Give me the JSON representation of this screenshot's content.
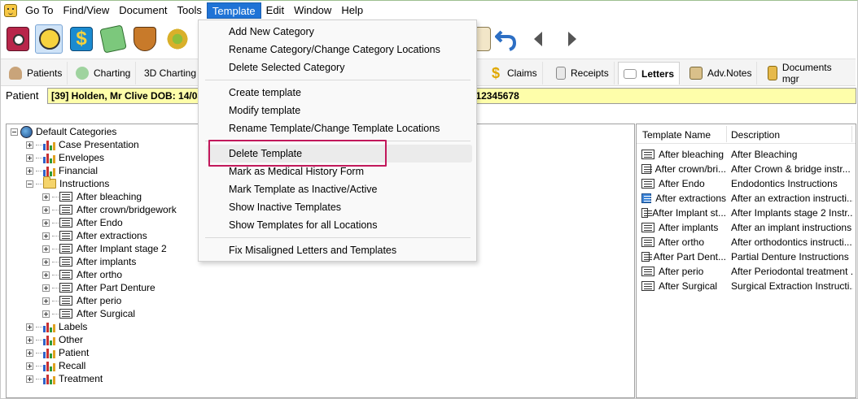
{
  "menubar": {
    "items": [
      "Go To",
      "Find/View",
      "Document",
      "Tools",
      "Template",
      "Edit",
      "Window",
      "Help"
    ],
    "active": "Template"
  },
  "toolbar_icons": [
    "appointment-book-icon",
    "patient-smiley-icon",
    "accounts-dollar-icon",
    "mail-icon",
    "shield-icon",
    "settings-gears-icon",
    "clipboard-icon",
    "undo-arrow-icon",
    "back-arrow-icon",
    "forward-arrow-icon"
  ],
  "navtabs": [
    {
      "label": "Patients",
      "icon": "patient-icon"
    },
    {
      "label": "Charting",
      "icon": "tooth-icon"
    },
    {
      "label": "3D Charting",
      "icon": ""
    },
    {
      "label": "Claims",
      "icon": "dollar-icon"
    },
    {
      "label": "Receipts",
      "icon": "receipt-icon"
    },
    {
      "label": "Letters",
      "icon": "envelope-icon",
      "selected": true
    },
    {
      "label": "Adv.Notes",
      "icon": "notes-icon"
    },
    {
      "label": "Documents mgr",
      "icon": "folder-icon"
    }
  ],
  "patient": {
    "label": "Patient",
    "value": "[39] Holden, Mr Clive DOB: 14/03/",
    "value_tail": "; mob:0412345678"
  },
  "template_menu": {
    "group1": [
      "Add New Category",
      "Rename Category/Change Category Locations",
      "Delete Selected Category"
    ],
    "group2": [
      "Create template",
      "Modify template",
      "Rename Template/Change Template Locations"
    ],
    "group3": [
      "Delete Template",
      "Mark as Medical History Form",
      "Mark Template as Inactive/Active",
      "Show Inactive Templates",
      "Show Templates for all Locations"
    ],
    "group4": [
      "Fix Misaligned Letters and Templates"
    ],
    "highlighted": "Delete Template"
  },
  "tree": {
    "root": "Default Categories",
    "categories_before": [
      "Case Presentation",
      "Envelopes",
      "Financial"
    ],
    "open_category": "Instructions",
    "templates": [
      "After bleaching",
      "After crown/bridgework",
      "After Endo",
      "After extractions",
      "After Implant stage 2",
      "After implants",
      "After ortho",
      "After Part Denture",
      "After perio",
      "After Surgical"
    ],
    "categories_after": [
      "Labels",
      "Other",
      "Patient",
      "Recall",
      "Treatment"
    ]
  },
  "template_list": {
    "columns": [
      "Template Name",
      "Description"
    ],
    "rows": [
      {
        "name": "After bleaching",
        "desc": "After Bleaching"
      },
      {
        "name": "After crown/bri...",
        "desc": "After Crown & bridge instr..."
      },
      {
        "name": "After Endo",
        "desc": "Endodontics Instructions"
      },
      {
        "name": "After extractions",
        "desc": "After an extraction instructi...",
        "selected": true
      },
      {
        "name": "After Implant st...",
        "desc": "After Implants stage 2 Instr..."
      },
      {
        "name": "After implants",
        "desc": "After an implant instructions"
      },
      {
        "name": "After ortho",
        "desc": "After orthodontics instructi..."
      },
      {
        "name": "After Part Dent...",
        "desc": "Partial Denture Instructions"
      },
      {
        "name": "After perio",
        "desc": "After Periodontal treatment ..."
      },
      {
        "name": "After Surgical",
        "desc": "Surgical Extraction Instructi..."
      }
    ]
  },
  "colors": {
    "menu_active": "#1f73d6",
    "patient_field": "#fefeaa",
    "highlight_box": "#c2185b"
  }
}
